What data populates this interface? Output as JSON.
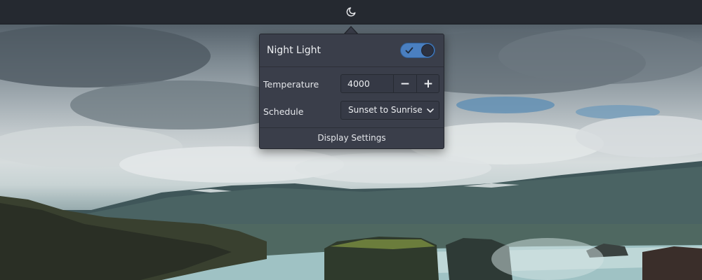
{
  "topbar": {
    "indicator_icon": "night-light-moon-icon"
  },
  "popover": {
    "night_light": {
      "label": "Night Light",
      "enabled": true
    },
    "temperature": {
      "label": "Temperature",
      "value": "4000",
      "decrement_label": "−",
      "increment_label": "+"
    },
    "schedule": {
      "label": "Schedule",
      "selected": "Sunset to Sunrise"
    },
    "display_settings_label": "Display Settings"
  },
  "colors": {
    "accent": "#4a7fc0",
    "panel": "#252930",
    "popover_bg": "#3a3e4a"
  }
}
